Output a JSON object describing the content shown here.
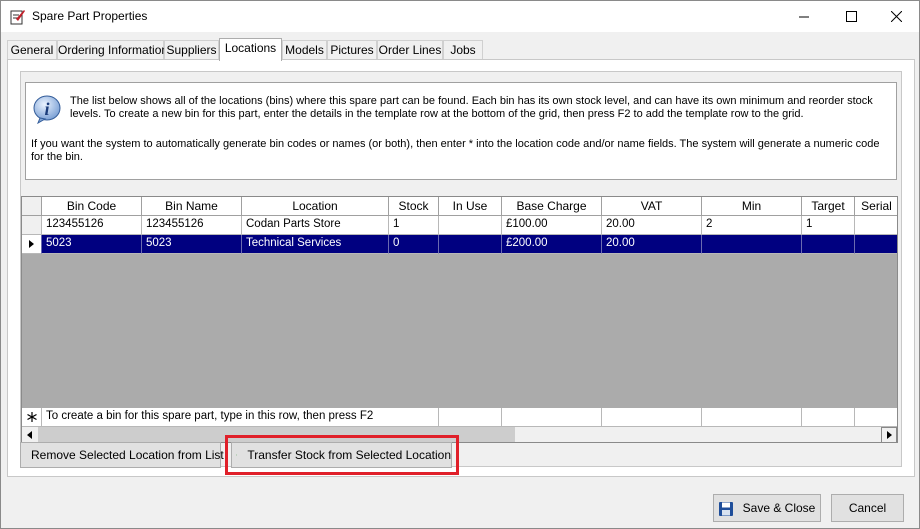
{
  "window": {
    "title": "Spare Part Properties"
  },
  "tabs": [
    {
      "label": "General"
    },
    {
      "label": "Ordering Information"
    },
    {
      "label": "Suppliers"
    },
    {
      "label": "Locations"
    },
    {
      "label": "Models"
    },
    {
      "label": "Pictures"
    },
    {
      "label": "Order Lines"
    },
    {
      "label": "Jobs"
    }
  ],
  "active_tab": "Locations",
  "info": {
    "text1": "The list below shows all of the locations (bins) where this spare part can be found. Each bin has its own stock level, and can have its own minimum and reorder stock levels. To create a new bin for this part, enter the details in the template row at the bottom of the grid, then press F2 to add the template row to the grid.",
    "text2": "If you want the system to automatically generate bin codes or names (or both), then enter * into the location code and/or name fields. The system will generate a numeric code for the bin."
  },
  "grid": {
    "columns": [
      "Bin Code",
      "Bin Name",
      "Location",
      "Stock",
      "In Use",
      "Base Charge",
      "VAT",
      "Min",
      "Target",
      "Serial"
    ],
    "rows": [
      [
        "123455126",
        "123455126",
        "Codan Parts Store",
        "1",
        "",
        "£100.00",
        "20.00",
        "2",
        "1",
        ""
      ],
      [
        "5023",
        "5023",
        "Technical Services",
        "0",
        "",
        "£200.00",
        "20.00",
        "",
        "",
        ""
      ]
    ],
    "selected_row": 1,
    "template_hint": "To create a bin for this spare part, type in this row, then press F2"
  },
  "buttons": {
    "remove": "Remove Selected Location from List",
    "transfer": "Transfer Stock from Selected Location",
    "save_close": "Save & Close",
    "cancel": "Cancel"
  },
  "colors": {
    "selection": "#000080",
    "highlight_box": "#e0202a"
  }
}
